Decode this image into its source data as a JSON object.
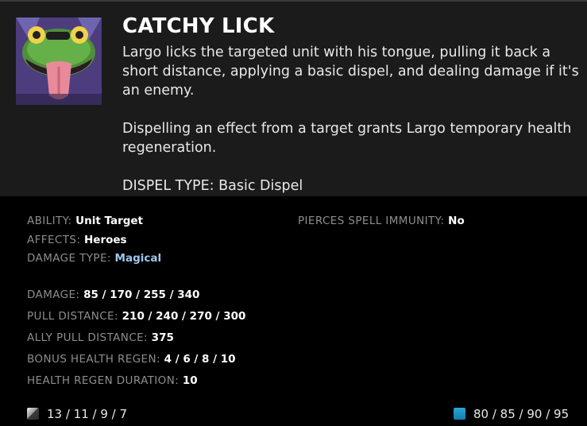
{
  "ability": {
    "name": "CATCHY LICK",
    "icon": "frog-tongue-icon",
    "description_1": "Largo licks the targeted unit with his tongue, pulling it back a short distance, applying a basic dispel, and dealing damage if it's an enemy.",
    "description_2": "Dispelling an effect from a target grants Largo temporary health regeneration.",
    "description_3": "DISPEL TYPE: Basic Dispel"
  },
  "attributes": {
    "ability_label": "ABILITY:",
    "ability_value": "Unit Target",
    "affects_label": "AFFECTS:",
    "affects_value": "Heroes",
    "damage_type_label": "DAMAGE TYPE:",
    "damage_type_value": "Magical",
    "pierces_label": "PIERCES SPELL IMMUNITY:",
    "pierces_value": "No"
  },
  "values": {
    "damage_label": "DAMAGE:",
    "damage_value": "85 / 170 / 255 / 340",
    "pull_label": "PULL DISTANCE:",
    "pull_value": "210 / 240 / 270 / 300",
    "ally_pull_label": "ALLY PULL DISTANCE:",
    "ally_pull_value": "375",
    "regen_label": "BONUS HEALTH REGEN:",
    "regen_value": "4 / 6 / 8 / 10",
    "regen_duration_label": "HEALTH REGEN DURATION:",
    "regen_duration_value": "10"
  },
  "footer": {
    "cooldown_icon": "cooldown-icon",
    "cooldown": "13 / 11 / 9 / 7",
    "mana_icon": "mana-icon",
    "mana": "80 / 85 / 90 / 95"
  },
  "colors": {
    "header_bg": "#1b1b1b",
    "body_bg": "#000000",
    "label": "#8d8d8d",
    "magical": "#9cc8ee",
    "mana": "#1a8fc6"
  }
}
